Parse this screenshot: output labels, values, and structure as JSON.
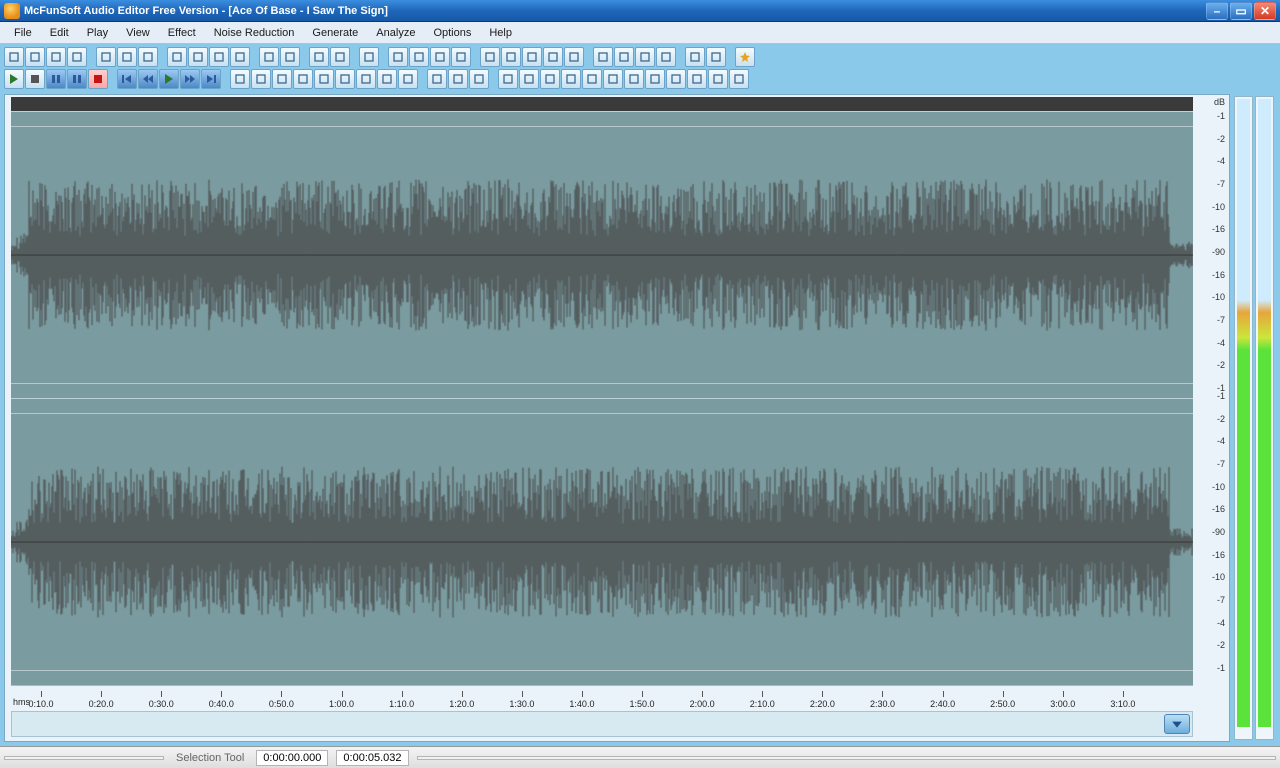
{
  "window": {
    "title": "McFunSoft Audio Editor Free Version - [Ace Of Base - I Saw The Sign]"
  },
  "menu": {
    "items": [
      "File",
      "Edit",
      "Play",
      "View",
      "Effect",
      "Noise Reduction",
      "Generate",
      "Analyze",
      "Options",
      "Help"
    ]
  },
  "toolbar": {
    "row1_groups": [
      [
        "new-file",
        "open-file",
        "save-file",
        "copy"
      ],
      [
        "undo",
        "redo",
        "repeat"
      ],
      [
        "cut",
        "copy2",
        "paste",
        "delete"
      ],
      [
        "crop",
        "trim"
      ],
      [
        "mix",
        "mix-paste"
      ],
      [
        "print"
      ],
      [
        "vol-plus",
        "vol-minus",
        "fade-in",
        "fade-out"
      ],
      [
        "normalize",
        "amplify",
        "compressor",
        "equalizer",
        "envelope"
      ],
      [
        "effect1",
        "effect2",
        "filters",
        "spectral"
      ],
      [
        "marker1",
        "marker2"
      ],
      [
        "star"
      ]
    ],
    "row2_groups": [
      [
        "play",
        "stop",
        "pause",
        "pause2",
        "record"
      ],
      [
        "skip-start",
        "rewind",
        "play2",
        "ffwd",
        "skip-end"
      ],
      [
        "tool1",
        "tool2",
        "tool3",
        "tool4",
        "tool5",
        "tool6",
        "tool7",
        "tool8",
        "tool9"
      ],
      [
        "fx1",
        "fx2",
        "fx3"
      ],
      [
        "a1",
        "a2",
        "a3",
        "a4",
        "a5",
        "a6",
        "a7",
        "a8",
        "a9",
        "a10",
        "a11",
        "a12"
      ]
    ]
  },
  "waveform": {
    "db_label": "dB",
    "db_ticks": [
      "-1",
      "-2",
      "-4",
      "-7",
      "-10",
      "-16",
      "-90",
      "-16",
      "-10",
      "-7",
      "-4",
      "-2",
      "-1"
    ],
    "time_unit": "hms",
    "time_ticks": [
      "0:10.0",
      "0:20.0",
      "0:30.0",
      "0:40.0",
      "0:50.0",
      "1:00.0",
      "1:10.0",
      "1:20.0",
      "1:30.0",
      "1:40.0",
      "1:50.0",
      "2:00.0",
      "2:10.0",
      "2:20.0",
      "2:30.0",
      "2:40.0",
      "2:50.0",
      "3:00.0",
      "3:10.0"
    ],
    "total_ticks": 19
  },
  "status": {
    "tool": "Selection Tool",
    "cursor": "0:00:00.000",
    "selection_end": "0:00:05.032"
  }
}
